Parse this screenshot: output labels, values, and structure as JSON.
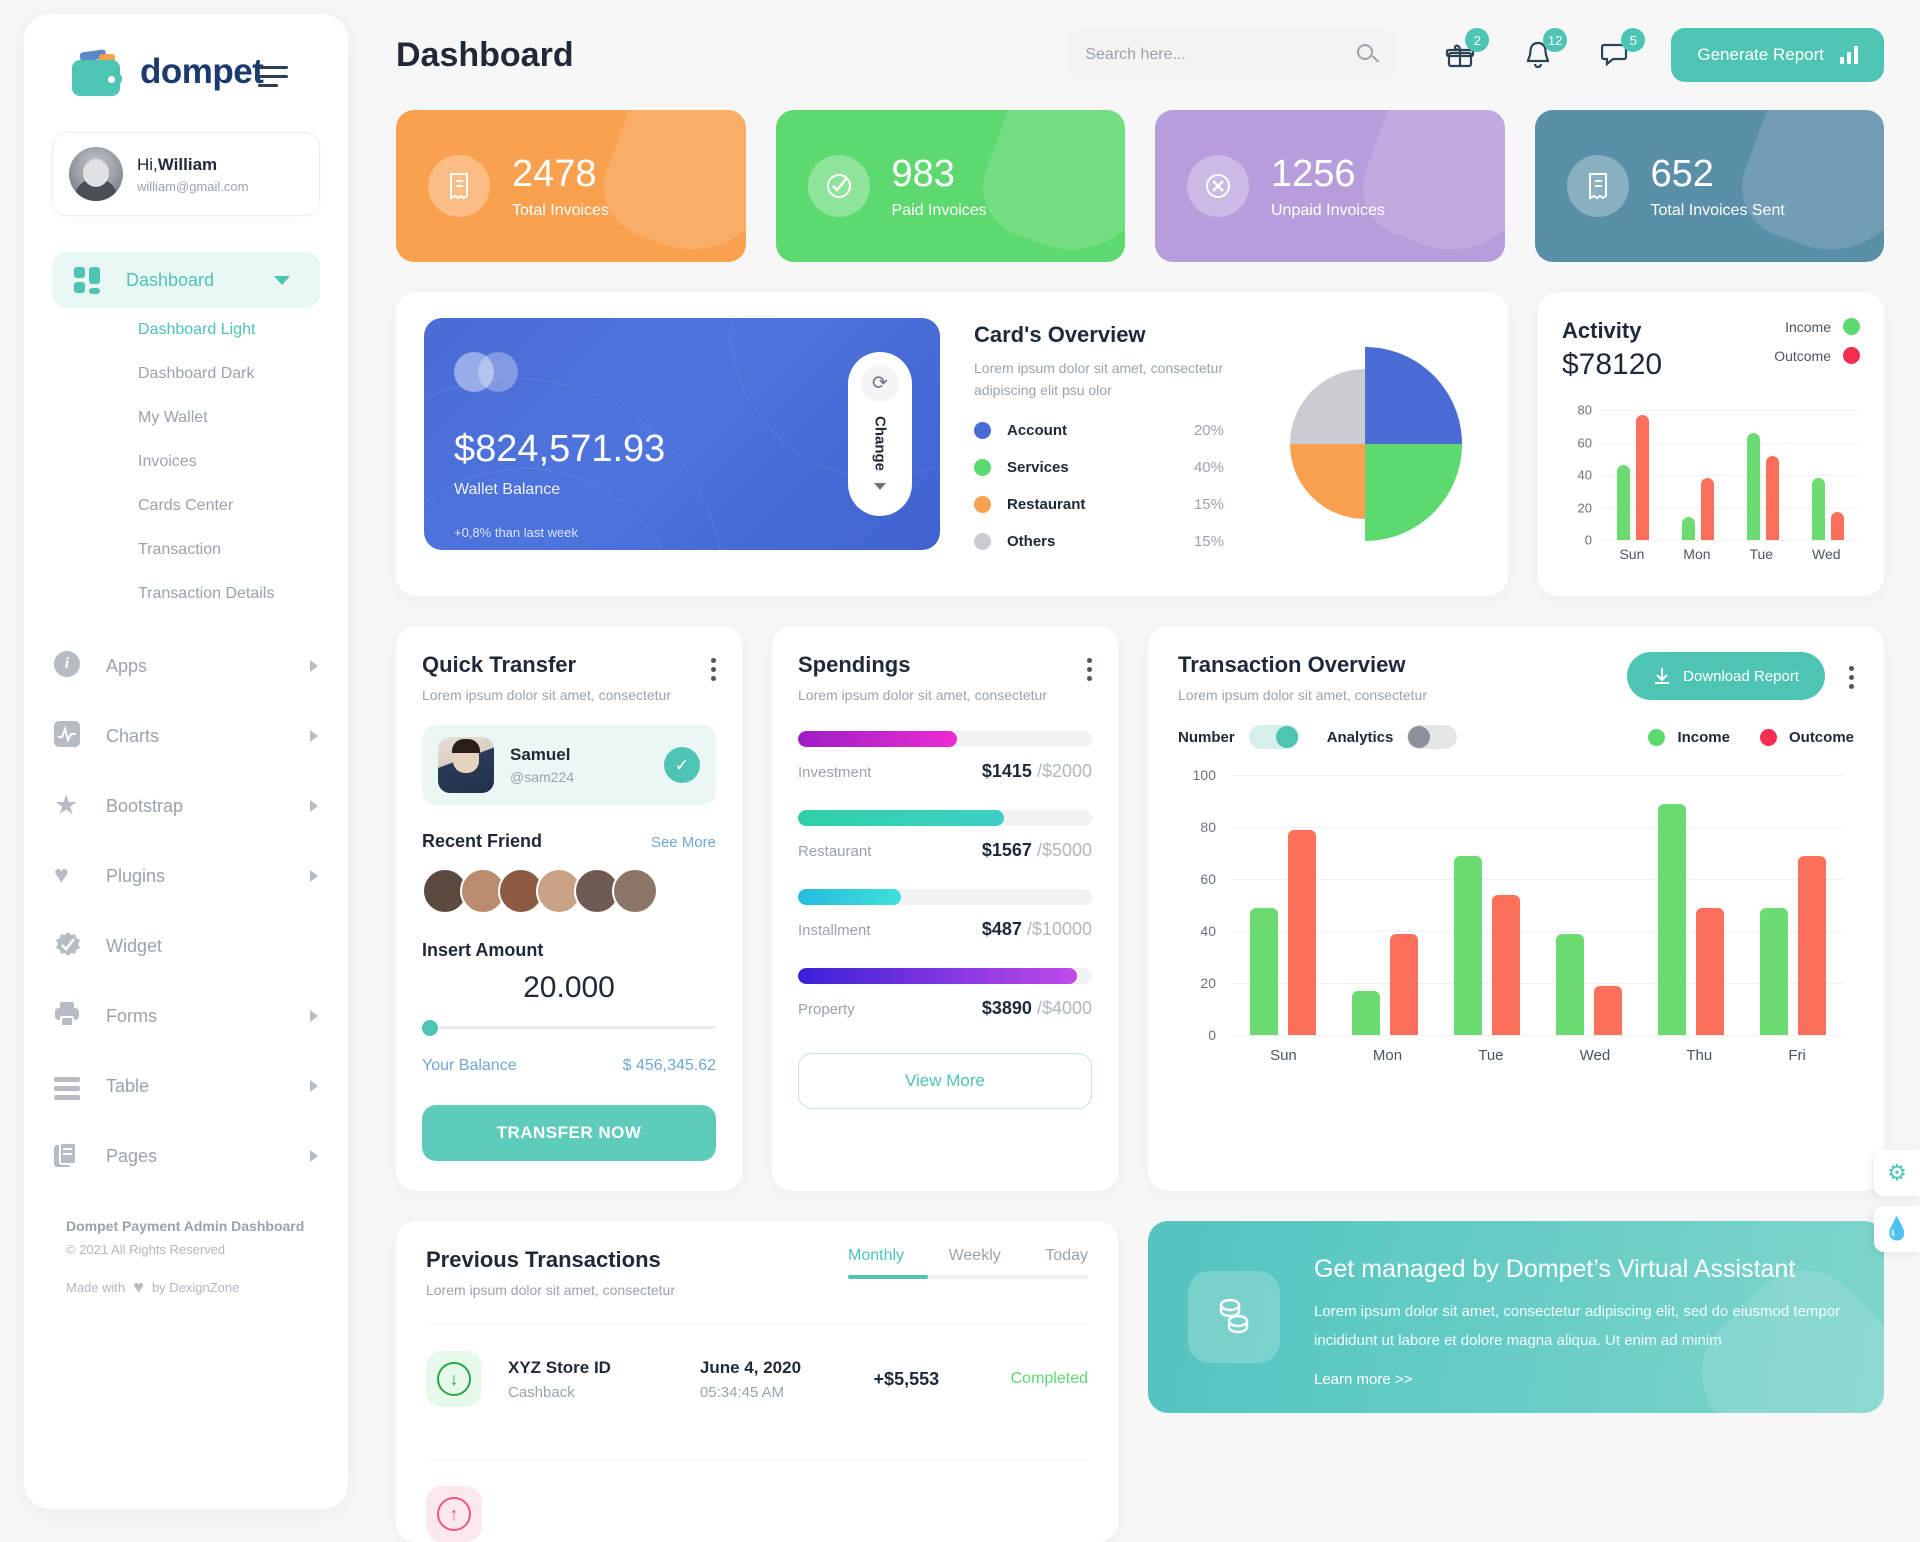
{
  "brand": {
    "name": "dompet"
  },
  "profile": {
    "greeting_prefix": "Hi,",
    "name": "William",
    "email": "william@gmail.com"
  },
  "sidebar": {
    "active_item": "Dashboard",
    "items": [
      {
        "label": "Dashboard",
        "icon": "grid-icon",
        "expanded": true
      },
      {
        "label": "Apps",
        "icon": "info-circle-icon"
      },
      {
        "label": "Charts",
        "icon": "chart-activity-icon"
      },
      {
        "label": "Bootstrap",
        "icon": "star-icon"
      },
      {
        "label": "Plugins",
        "icon": "heart-icon"
      },
      {
        "label": "Widget",
        "icon": "badge-check-icon"
      },
      {
        "label": "Forms",
        "icon": "printer-icon"
      },
      {
        "label": "Table",
        "icon": "table-icon"
      },
      {
        "label": "Pages",
        "icon": "pages-icon"
      }
    ],
    "sub_items": [
      {
        "label": "Dashboard Light",
        "active": true
      },
      {
        "label": "Dashboard Dark",
        "active": false
      },
      {
        "label": "My Wallet",
        "active": false
      },
      {
        "label": "Invoices",
        "active": false
      },
      {
        "label": "Cards Center",
        "active": false
      },
      {
        "label": "Transaction",
        "active": false
      },
      {
        "label": "Transaction Details",
        "active": false
      }
    ],
    "footer": {
      "title": "Dompet Payment Admin Dashboard",
      "copyright": "© 2021 All Rights Reserved",
      "made_prefix": "Made with",
      "made_suffix": "by DexignZone"
    }
  },
  "header": {
    "page_title": "Dashboard",
    "search_placeholder": "Search here...",
    "search_value": "",
    "gift_badge": "2",
    "bell_badge": "12",
    "chat_badge": "5",
    "generate_report_label": "Generate Report"
  },
  "stats": [
    {
      "value": "2478",
      "label": "Total Invoices",
      "color": "#f7a košice"
    },
    {
      "value": "983",
      "label": "Paid Invoices",
      "color": "#5ad870"
    },
    {
      "value": "1256",
      "label": "Unpaid Invoices",
      "color": "#b39ddb"
    },
    {
      "value": "652",
      "label": "Total Invoices Sent",
      "color": "#5d8aa8"
    }
  ],
  "stat_cards": [
    {
      "value": "2478",
      "label": "Total Invoices",
      "bg": "#f9a14f",
      "icon": "invoice-icon"
    },
    {
      "value": "983",
      "label": "Paid Invoices",
      "bg": "#5ed96f",
      "icon": "check-circle-icon"
    },
    {
      "value": "1256",
      "label": "Unpaid Invoices",
      "bg": "#b79ddb",
      "icon": "x-circle-icon"
    },
    {
      "value": "652",
      "label": "Total Invoices Sent",
      "bg": "#5a8fa8",
      "icon": "invoice-sent-icon"
    }
  ],
  "wallet": {
    "amount": "$824,571.93",
    "label": "Wallet Balance",
    "change": "+0,8% than last week",
    "change_button": "Change"
  },
  "cards_overview": {
    "title": "Card's Overview",
    "subtitle": "Lorem ipsum dolor sit amet, consectetur adipiscing elit psu olor"
  },
  "activity": {
    "title": "Activity",
    "amount": "$78120",
    "legend_income": "Income",
    "legend_outcome": "Outcome"
  },
  "quick_transfer": {
    "title": "Quick Transfer",
    "subtitle": "Lorem ipsum dolor sit amet, consectetur",
    "selected_name": "Samuel",
    "selected_handle": "@sam224",
    "recent_friend_title": "Recent Friend",
    "see_more": "See More",
    "insert_amount_label": "Insert Amount",
    "amount": "20.000",
    "balance_label": "Your Balance",
    "balance_value": "$ 456,345.62",
    "transfer_button": "TRANSFER NOW"
  },
  "spendings": {
    "title": "Spendings",
    "subtitle": "Lorem ipsum dolor sit amet, consectetur",
    "view_more": "View More"
  },
  "transaction_overview": {
    "title": "Transaction Overview",
    "subtitle": "Lorem ipsum dolor sit amet, consectetur",
    "download_label": "Download Report",
    "toggle_number_label": "Number",
    "toggle_analytics_label": "Analytics",
    "legend_income": "Income",
    "legend_outcome": "Outcome"
  },
  "previous_transactions": {
    "title": "Previous Transactions",
    "subtitle": "Lorem ipsum dolor sit amet, consectetur",
    "tabs": [
      {
        "label": "Monthly",
        "active": true
      },
      {
        "label": "Weekly",
        "active": false
      },
      {
        "label": "Today",
        "active": false
      }
    ],
    "rows": [
      {
        "name": "XYZ Store ID",
        "type": "Cashback",
        "date": "June 4, 2020",
        "time": "05:34:45 AM",
        "amount": "+$5,553",
        "status": "Completed",
        "direction": "in"
      }
    ]
  },
  "virtual_assistant": {
    "title": "Get managed by Dompet’s Virtual Assistant",
    "body": "Lorem ipsum dolor sit amet, consectetur adipiscing elit, sed do eiusmod tempor incididunt ut labore et dolore magna aliqua. Ut enim ad minim",
    "link": "Learn more >>"
  },
  "float_buttons": [
    {
      "icon": "gear-icon"
    },
    {
      "icon": "droplet-icon"
    }
  ],
  "colors": {
    "accent": "#4dc4b4",
    "income": "#6cdb72",
    "outcome": "#fc6f5b",
    "blue": "#4a6cd4"
  },
  "chart_data": [
    {
      "type": "pie",
      "title": "Card's Overview",
      "labels": [
        "Account",
        "Services",
        "Restaurant",
        "Others"
      ],
      "values": [
        20,
        40,
        15,
        15
      ],
      "value_labels": [
        "20%",
        "40%",
        "15%",
        "15%"
      ],
      "colors": [
        "#4a6cd4",
        "#5ed96f",
        "#f9a14f",
        "#c9cdd2"
      ],
      "legend": "left"
    },
    {
      "type": "bar",
      "title": "Activity",
      "categories": [
        "Sun",
        "Mon",
        "Tue",
        "Wed"
      ],
      "series": [
        {
          "name": "Income",
          "color": "#6cdb72",
          "values": [
            46,
            14,
            66,
            38
          ]
        },
        {
          "name": "Outcome",
          "color": "#fc6f5b",
          "values": [
            77,
            38,
            52,
            17
          ]
        }
      ],
      "yticks": [
        0,
        20,
        40,
        60,
        80
      ],
      "ylim": [
        0,
        80
      ],
      "grid": true,
      "legend": "top-right"
    },
    {
      "type": "bar",
      "title": "Spendings",
      "categories": [
        "Investment",
        "Restaurant",
        "Installment",
        "Property"
      ],
      "values": [
        1415,
        1567,
        487,
        3890
      ],
      "maxima": [
        2000,
        5000,
        10000,
        4000
      ],
      "value_labels": [
        "$1415",
        "$1567",
        "$487",
        "$3890"
      ],
      "max_labels": [
        "/$2000",
        "/$5000",
        "/$10000",
        "/$4000"
      ],
      "bar_percents": [
        54,
        70,
        35,
        95
      ],
      "colors_from": [
        "#a020c0",
        "#2fd0a6",
        "#25bce0",
        "#3b1fd8"
      ],
      "colors_to": [
        "#ef2ad4",
        "#3ed0c8",
        "#3fe0d8",
        "#c04ae8"
      ],
      "orientation": "horizontal"
    },
    {
      "type": "bar",
      "title": "Transaction Overview",
      "categories": [
        "Sun",
        "Mon",
        "Tue",
        "Wed",
        "Thu",
        "Fri"
      ],
      "series": [
        {
          "name": "Income",
          "color": "#6cdb72",
          "values": [
            49,
            17,
            69,
            39,
            89,
            49
          ]
        },
        {
          "name": "Outcome",
          "color": "#fc6f5b",
          "values": [
            79,
            39,
            54,
            19,
            49,
            69
          ]
        }
      ],
      "yticks": [
        0,
        20,
        40,
        60,
        80,
        100
      ],
      "ylim": [
        0,
        100
      ],
      "grid": true,
      "legend": "top-right"
    }
  ]
}
